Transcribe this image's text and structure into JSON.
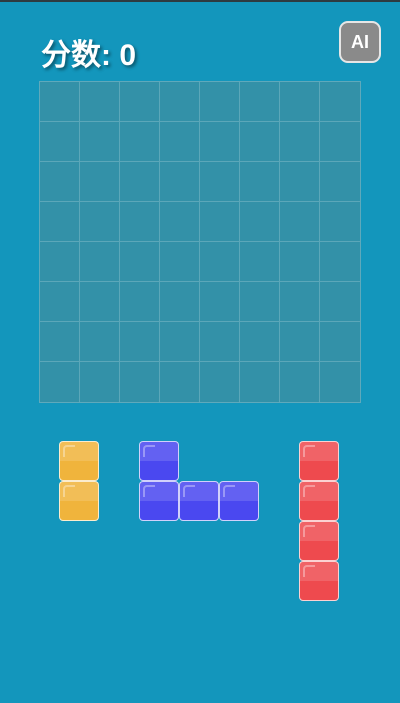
{
  "header": {
    "score_label": "分数:",
    "score_value": "0",
    "ai_button_label": "AI"
  },
  "board": {
    "rows": 8,
    "cols": 8
  },
  "pieces": [
    {
      "name": "yellow-piece",
      "color": "#f0b43c",
      "cells": [
        [
          0,
          0
        ],
        [
          1,
          0
        ]
      ]
    },
    {
      "name": "blue-piece",
      "color": "#4a48f0",
      "cells": [
        [
          0,
          0
        ],
        [
          1,
          0
        ],
        [
          1,
          1
        ],
        [
          1,
          2
        ]
      ]
    },
    {
      "name": "red-piece",
      "color": "#ee4a4e",
      "cells": [
        [
          0,
          0
        ],
        [
          1,
          0
        ],
        [
          2,
          0
        ],
        [
          3,
          0
        ]
      ]
    }
  ]
}
